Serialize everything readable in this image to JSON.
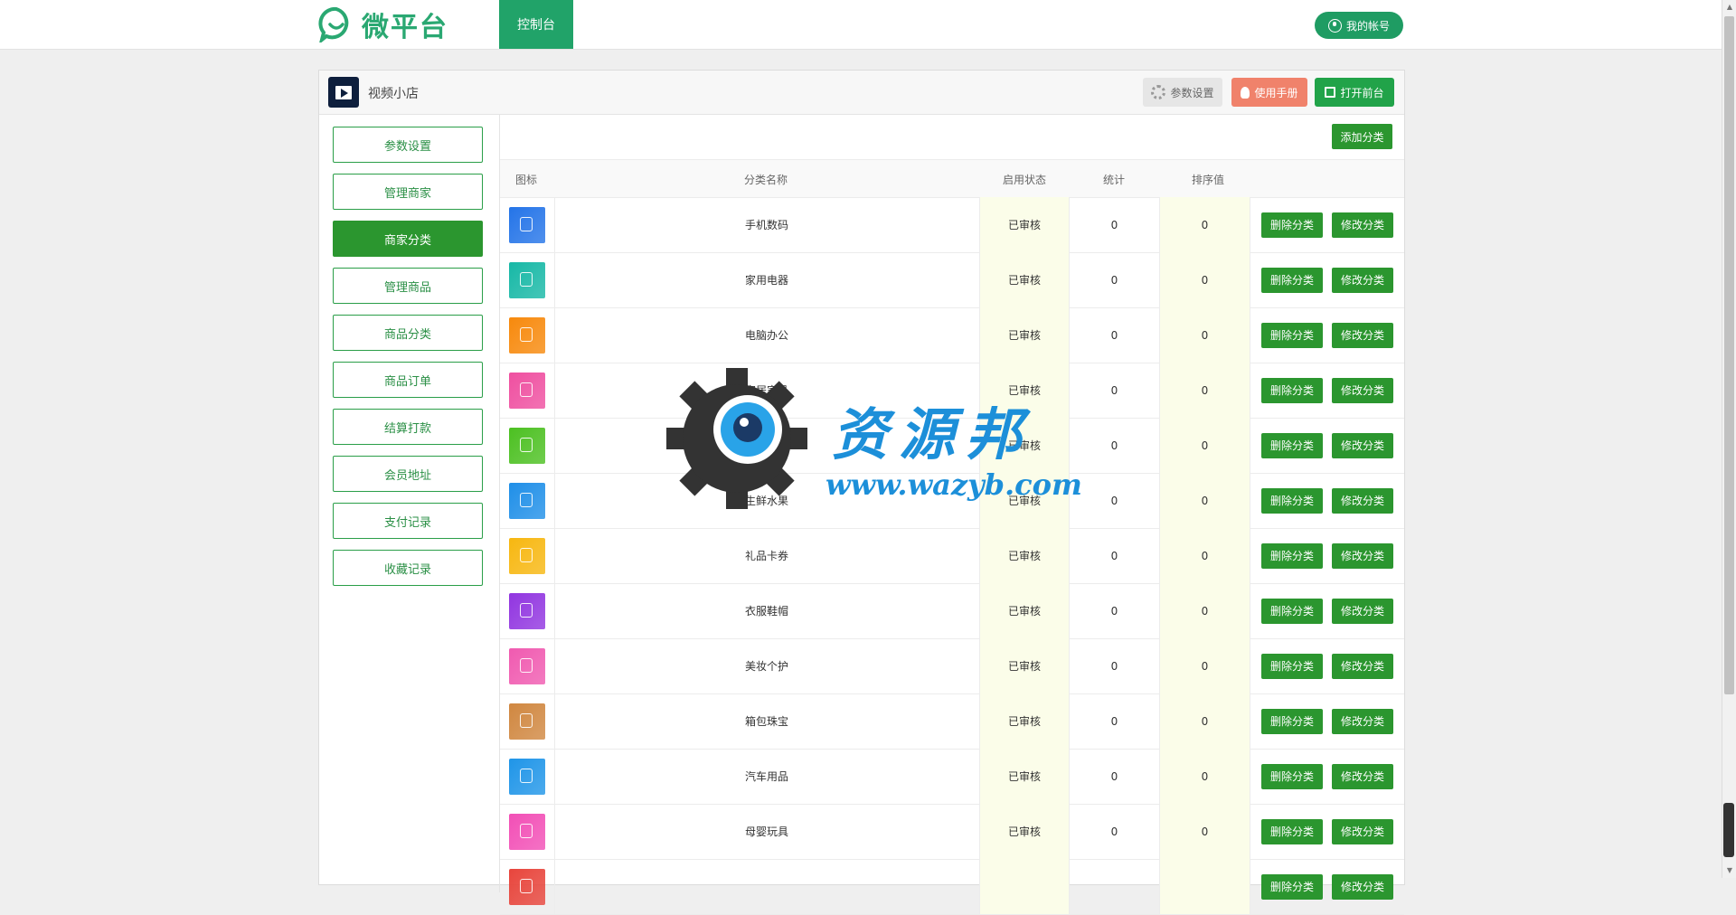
{
  "topbar": {
    "logo_text": "微平台",
    "nav_dashboard": "控制台",
    "account_label": "我的帐号"
  },
  "panel": {
    "app_title": "视频小店",
    "btn_settings": "参数设置",
    "btn_manual": "使用手册",
    "btn_open_front": "打开前台"
  },
  "sidebar": {
    "items": [
      {
        "label": "参数设置",
        "active": false
      },
      {
        "label": "管理商家",
        "active": false
      },
      {
        "label": "商家分类",
        "active": true
      },
      {
        "label": "管理商品",
        "active": false
      },
      {
        "label": "商品分类",
        "active": false
      },
      {
        "label": "商品订单",
        "active": false
      },
      {
        "label": "结算打款",
        "active": false
      },
      {
        "label": "会员地址",
        "active": false
      },
      {
        "label": "支付记录",
        "active": false
      },
      {
        "label": "收藏记录",
        "active": false
      }
    ]
  },
  "table": {
    "add_button": "添加分类",
    "headers": {
      "icon": "图标",
      "name": "分类名称",
      "status": "启用状态",
      "count": "统计",
      "sort": "排序值"
    },
    "delete_label": "删除分类",
    "edit_label": "修改分类",
    "rows": [
      {
        "name": "手机数码",
        "status": "已审核",
        "count": "0",
        "sort": "0",
        "color": "#2474e8"
      },
      {
        "name": "家用电器",
        "status": "已审核",
        "count": "0",
        "sort": "0",
        "color": "#17b8a6"
      },
      {
        "name": "电脑办公",
        "status": "已审核",
        "count": "0",
        "sort": "0",
        "color": "#f7890c"
      },
      {
        "name": "家居家具",
        "status": "已审核",
        "count": "0",
        "sort": "0",
        "color": "#ef4fa0"
      },
      {
        "name": "食品饮料",
        "status": "已审核",
        "count": "0",
        "sort": "0",
        "color": "#4cc021"
      },
      {
        "name": "生鲜水果",
        "status": "已审核",
        "count": "0",
        "sort": "0",
        "color": "#1f8fe8"
      },
      {
        "name": "礼品卡券",
        "status": "已审核",
        "count": "0",
        "sort": "0",
        "color": "#f7b710"
      },
      {
        "name": "衣服鞋帽",
        "status": "已审核",
        "count": "0",
        "sort": "0",
        "color": "#9135e0"
      },
      {
        "name": "美妆个护",
        "status": "已审核",
        "count": "0",
        "sort": "0",
        "color": "#f05ab0"
      },
      {
        "name": "箱包珠宝",
        "status": "已审核",
        "count": "0",
        "sort": "0",
        "color": "#d08740"
      },
      {
        "name": "汽车用品",
        "status": "已审核",
        "count": "0",
        "sort": "0",
        "color": "#1f95e8"
      },
      {
        "name": "母婴玩具",
        "status": "已审核",
        "count": "0",
        "sort": "0",
        "color": "#f24fb6"
      },
      {
        "name": "",
        "status": "",
        "count": "",
        "sort": "",
        "color": "#e8453c"
      }
    ]
  },
  "watermark": {
    "title": "资源邦",
    "url": "www.wazyb.com"
  }
}
